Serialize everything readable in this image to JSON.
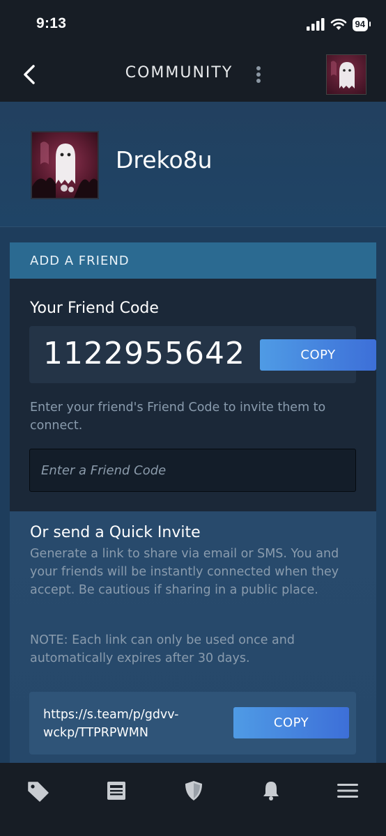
{
  "status_bar": {
    "time": "9:13",
    "battery": "94",
    "icons": [
      "signal-icon",
      "wifi-icon",
      "battery-icon"
    ]
  },
  "nav": {
    "title": "COMMUNITY",
    "back_icon": "chevron-left-icon",
    "menu_icon": "kebab-menu-icon"
  },
  "profile": {
    "username": "Dreko8u"
  },
  "add_friend": {
    "header": "ADD A FRIEND",
    "friend_code_heading": "Your Friend Code",
    "friend_code": "1122955642",
    "copy_label": "COPY",
    "invite_description": "Enter your friend's Friend Code to invite them to connect.",
    "input_placeholder": "Enter a Friend Code",
    "input_value": ""
  },
  "quick_invite": {
    "heading": "Or send a Quick Invite",
    "description": "Generate a link to share via email or SMS. You and your friends will be instantly connected when they accept. Be cautious if sharing in a public place.",
    "note": "NOTE: Each link can only be used once and automatically expires after 30 days.",
    "link": "https://s.team/p/gdvv-wckp/TTPRPWMN",
    "copy_label": "COPY"
  },
  "tab_bar": {
    "tabs": [
      "tag-icon",
      "news-icon",
      "shield-icon",
      "bell-icon",
      "hamburger-menu-icon"
    ]
  },
  "colors": {
    "nav_background": "#171d25",
    "header_band": "#2b6a91",
    "button_gradient_start": "#4f9be5",
    "button_gradient_end": "#3d6fd8",
    "muted_text": "#8a9cae"
  }
}
